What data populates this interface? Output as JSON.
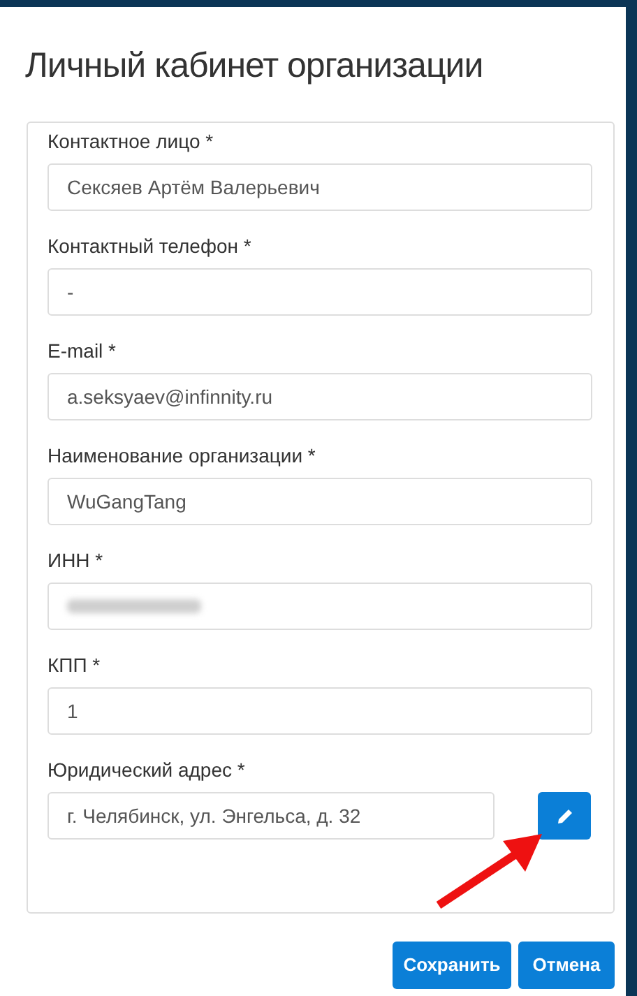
{
  "dialog": {
    "title": "Личный кабинет организации"
  },
  "fields": [
    {
      "kind": "text",
      "label": "Контактное лицо *",
      "value": "Сексяев Артём Валерьевич"
    },
    {
      "kind": "text",
      "label": "Контактный телефон *",
      "value": "-"
    },
    {
      "kind": "text",
      "label": "E-mail *",
      "value": "a.seksyaev@infinnity.ru"
    },
    {
      "kind": "text",
      "label": "Наименование организации *",
      "value": "WuGangTang"
    },
    {
      "kind": "redacted",
      "label": "ИНН *"
    },
    {
      "kind": "text",
      "label": "КПП *",
      "value": "1"
    },
    {
      "kind": "editable",
      "label": "Юридический адрес *",
      "value": "г. Челябинск, ул. Энгельса, д. 32"
    }
  ],
  "buttons": [
    "Сохранить",
    "Отмена"
  ]
}
